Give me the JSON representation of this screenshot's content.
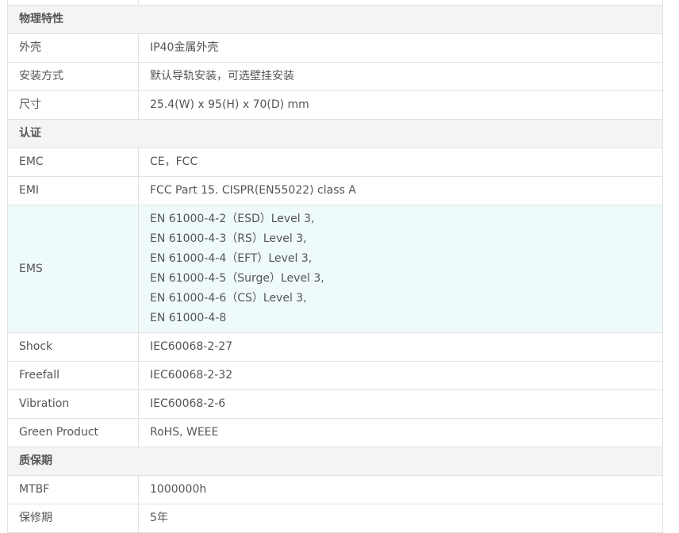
{
  "sections": [
    {
      "title": "物理特性",
      "rows": [
        {
          "label": "外壳",
          "value": [
            "IP40金属外壳"
          ]
        },
        {
          "label": "安装方式",
          "value": [
            "默认导轨安装，可选壁挂安装"
          ]
        },
        {
          "label": "尺寸",
          "value": [
            "25.4(W) x 95(H) x 70(D) mm"
          ]
        }
      ]
    },
    {
      "title": "认证",
      "rows": [
        {
          "label": "EMC",
          "value": [
            "CE，FCC"
          ]
        },
        {
          "label": "EMI",
          "value": [
            "FCC Part 15. CISPR(EN55022) class A"
          ]
        },
        {
          "label": "EMS",
          "highlight": true,
          "value": [
            "EN 61000-4-2（ESD）Level 3,",
            "EN 61000-4-3（RS）Level 3,",
            "EN 61000-4-4（EFT）Level 3,",
            "EN 61000-4-5（Surge）Level 3,",
            "EN 61000-4-6（CS）Level 3,",
            "EN 61000-4-8"
          ]
        },
        {
          "label": "Shock",
          "value": [
            "IEC60068-2-27"
          ]
        },
        {
          "label": "Freefall",
          "value": [
            "IEC60068-2-32"
          ]
        },
        {
          "label": "Vibration",
          "value": [
            "IEC60068-2-6"
          ]
        },
        {
          "label": "Green Product",
          "value": [
            "RoHS, WEEE"
          ]
        }
      ]
    },
    {
      "title": "质保期",
      "rows": [
        {
          "label": "MTBF",
          "value": [
            "1000000h"
          ]
        },
        {
          "label": "保修期",
          "value": [
            "5年"
          ]
        }
      ]
    }
  ],
  "colors": {
    "border": "#e2e2e2",
    "section_bg": "#f4f4f4",
    "highlight_bg": "#effafb",
    "text": "#555555"
  }
}
